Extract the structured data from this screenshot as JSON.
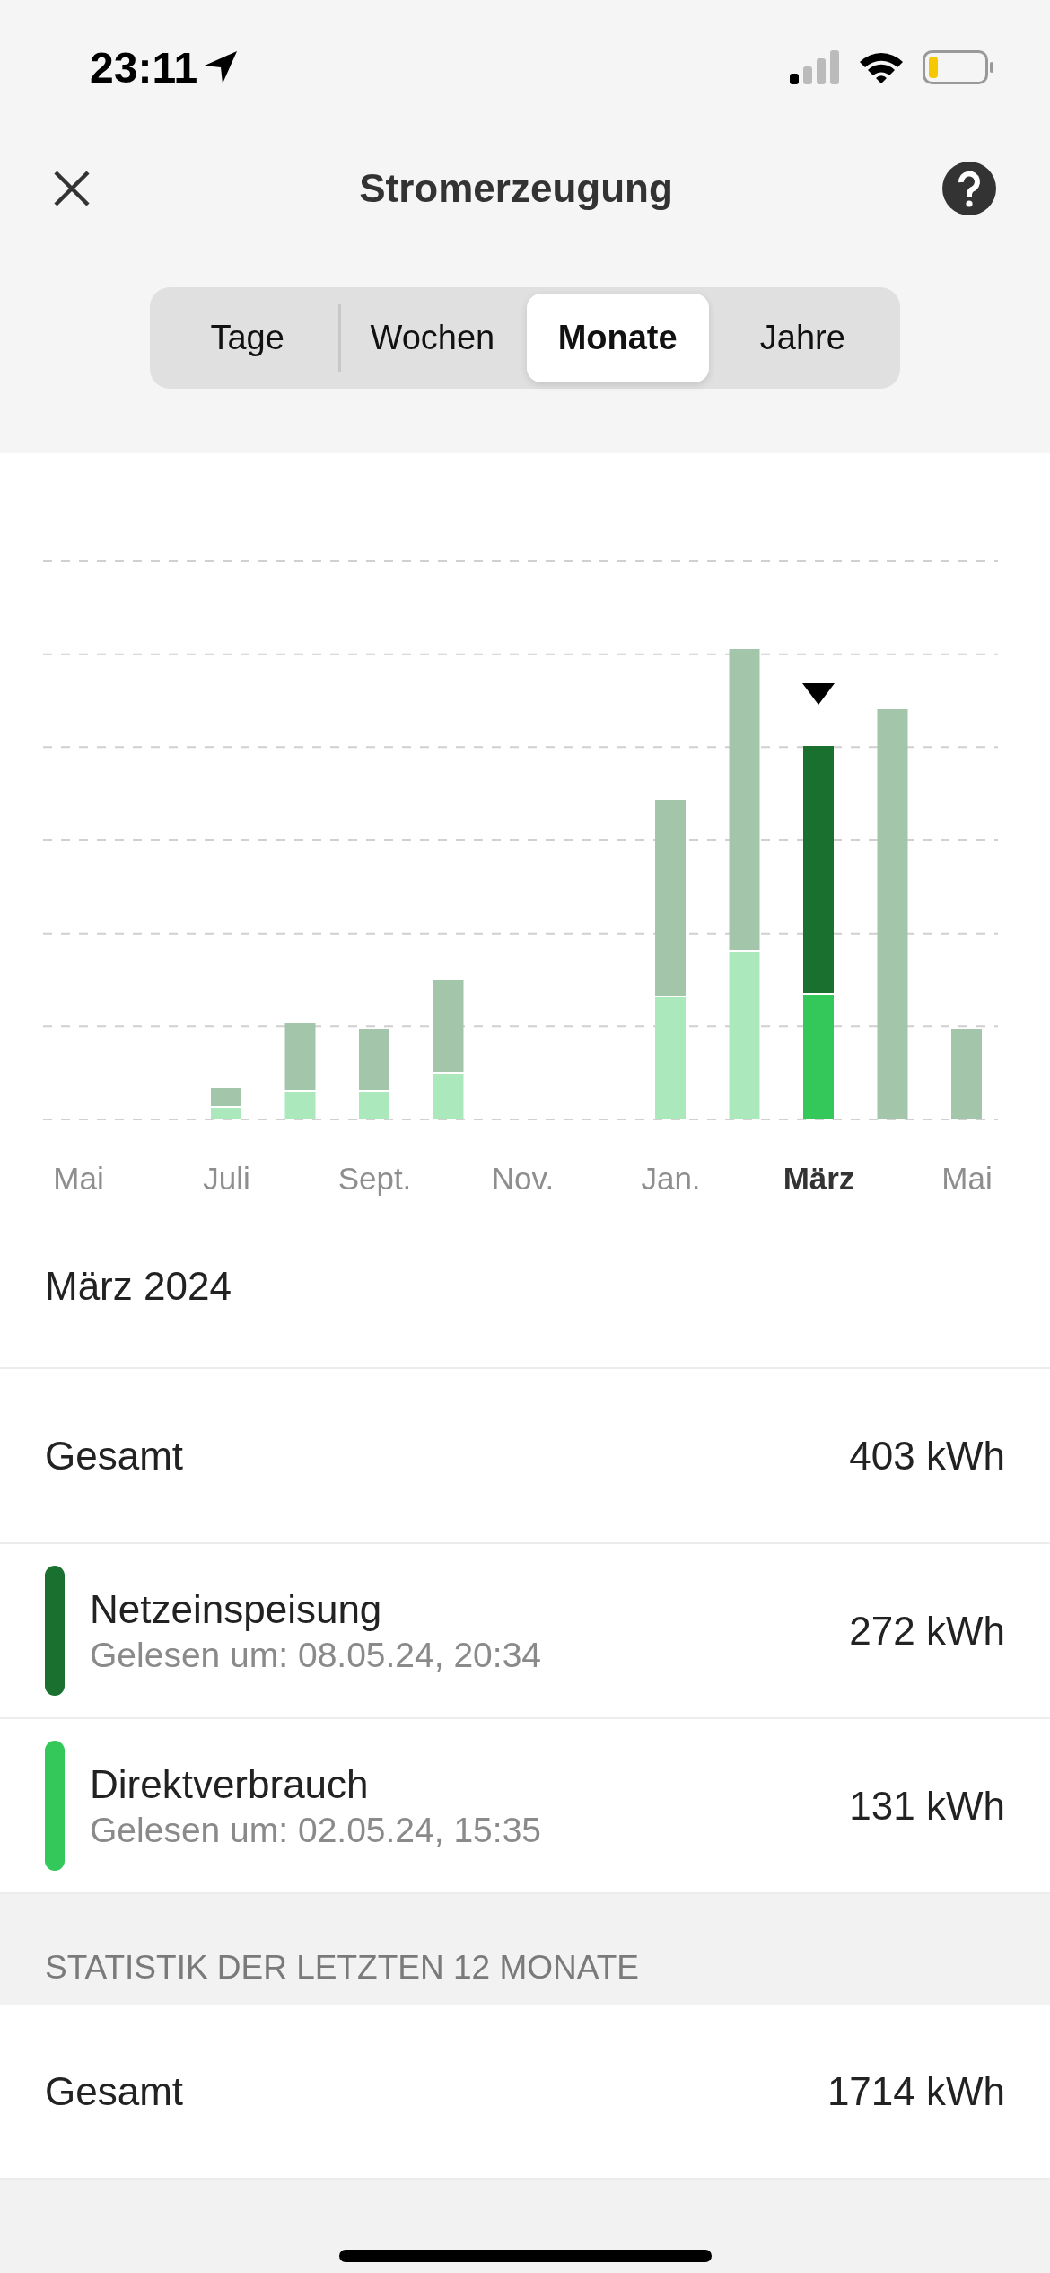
{
  "status_bar": {
    "time": "23:11"
  },
  "nav": {
    "title": "Stromerzeugung"
  },
  "segments": [
    {
      "label": "Tage",
      "selected": false
    },
    {
      "label": "Wochen",
      "selected": false
    },
    {
      "label": "Monate",
      "selected": true
    },
    {
      "label": "Jahre",
      "selected": false
    }
  ],
  "chart": {
    "x_labels": [
      {
        "label": "Mai",
        "selected": false
      },
      {
        "label": "Juli",
        "selected": false
      },
      {
        "label": "Sept.",
        "selected": false
      },
      {
        "label": "Nov.",
        "selected": false
      },
      {
        "label": "Jan.",
        "selected": false
      },
      {
        "label": "März",
        "selected": true
      },
      {
        "label": "Mai",
        "selected": false
      }
    ]
  },
  "period": {
    "title": "März 2024"
  },
  "summary": [
    {
      "kind": "total",
      "label": "Gesamt",
      "value": "403 kWh"
    },
    {
      "kind": "source",
      "label": "Netzeinspeisung",
      "subtitle": "Gelesen um: 08.05.24, 20:34",
      "value": "272 kWh",
      "color": "#19702f"
    },
    {
      "kind": "source",
      "label": "Direktverbrauch",
      "subtitle": "Gelesen um: 02.05.24, 15:35",
      "value": "131 kWh",
      "color": "#34c759"
    }
  ],
  "statistics": {
    "header": "STATISTIK DER LETZTEN 12 MONATE",
    "rows": [
      {
        "label": "Gesamt",
        "value": "1714 kWh"
      }
    ]
  }
}
